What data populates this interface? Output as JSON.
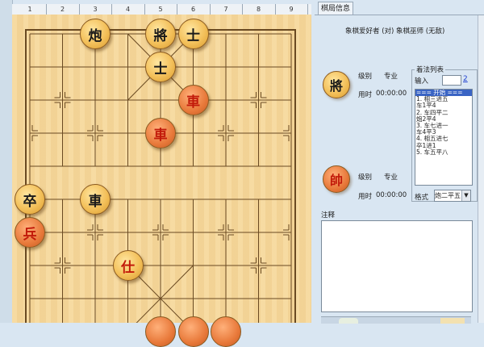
{
  "ruler": {
    "numbers": [
      "1",
      "2",
      "3",
      "4",
      "5",
      "6",
      "7",
      "8",
      "9"
    ]
  },
  "board": {
    "river_text": "",
    "pieces": [
      {
        "char": "炮",
        "side": "black",
        "file": 2,
        "rank": 0
      },
      {
        "char": "將",
        "side": "black",
        "file": 4,
        "rank": 0
      },
      {
        "char": "士",
        "side": "black",
        "file": 5,
        "rank": 0
      },
      {
        "char": "士",
        "side": "black",
        "file": 4,
        "rank": 1
      },
      {
        "char": "車",
        "side": "red",
        "file": 5,
        "rank": 2
      },
      {
        "char": "車",
        "side": "red",
        "file": 4,
        "rank": 3
      },
      {
        "char": "卒",
        "side": "black",
        "file": 0,
        "rank": 5
      },
      {
        "char": "車",
        "side": "black",
        "file": 2,
        "rank": 5
      },
      {
        "char": "兵",
        "side": "red",
        "file": 0,
        "rank": 6
      },
      {
        "char": "仕",
        "side": "red",
        "pale": true,
        "file": 3,
        "rank": 7
      },
      {
        "char": "",
        "side": "red",
        "partial": true,
        "file": 4,
        "rank": 9
      },
      {
        "char": "",
        "side": "red",
        "partial": true,
        "file": 5,
        "rank": 9
      },
      {
        "char": "",
        "side": "red",
        "partial": true,
        "file": 6,
        "rank": 9
      }
    ]
  },
  "panel": {
    "tab_label": "棋局信息",
    "players_line": "象棋爱好者 (对) 象棋巫师 (无敌)",
    "top_player": {
      "avatar": "將",
      "level_label": "级别",
      "level_value": "专业",
      "time_label": "用时",
      "time_value": "00:00:00"
    },
    "bottom_player": {
      "avatar": "帥",
      "level_label": "级别",
      "level_value": "专业",
      "time_label": "用时",
      "time_value": "00:00:00"
    },
    "moves": {
      "title": "着法列表",
      "input_label": "输入",
      "input_value": "",
      "input_link": "2",
      "items": [
        "=== 开始 ===",
        "1. 相三进五",
        "   车1平4",
        "2. 车四平二",
        "   炮2平4",
        "3. 车七进一",
        "   车4平3",
        "4. 相五进七",
        "   卒1进1",
        "5. 车五平八"
      ],
      "selected_index": 0
    },
    "format_label": "格式",
    "format_value": "炮二平五",
    "notes_label": "注释",
    "notes_value": ""
  }
}
